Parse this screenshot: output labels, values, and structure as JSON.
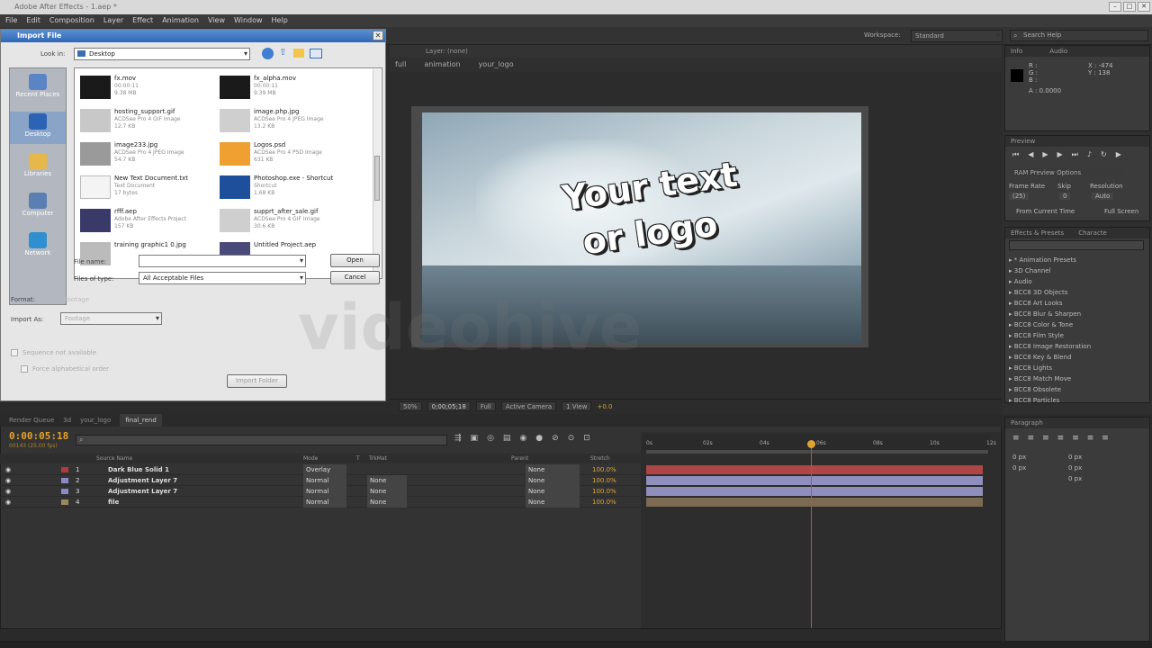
{
  "app": {
    "title": "Adobe After Effects - 1.aep *",
    "menu": [
      "File",
      "Edit",
      "Composition",
      "Layer",
      "Effect",
      "Animation",
      "View",
      "Window",
      "Help"
    ]
  },
  "workspace": {
    "label": "Workspace:",
    "value": "Standard",
    "search_placeholder": "Search Help"
  },
  "composition": {
    "layer_tab": "Layer: (none)",
    "nav": [
      "full",
      "animation",
      "your_logo"
    ],
    "canvas_text_line1": "Your text",
    "canvas_text_line2": "or logo",
    "zoom": "50%",
    "timecode": "0;00;05;18",
    "resolution": "Full",
    "camera": "Active Camera",
    "view": "1 View",
    "exposure": "+0.0"
  },
  "dialog": {
    "title": "Import File",
    "look_in_label": "Look in:",
    "look_in_value": "Desktop",
    "places": [
      "Recent Places",
      "Desktop",
      "Libraries",
      "Computer",
      "Network"
    ],
    "files": [
      {
        "name": "fx.mov",
        "sub1": "00:00:11",
        "sub2": "9.38 MB"
      },
      {
        "name": "fx_alpha.mov",
        "sub1": "00:00:11",
        "sub2": "9.39 MB"
      },
      {
        "name": "hosting_support.gif",
        "sub1": "ACDSee Pro 4 GIF Image",
        "sub2": "12.7 KB"
      },
      {
        "name": "image.php.jpg",
        "sub1": "ACDSee Pro 4 JPEG Image",
        "sub2": "13.2 KB"
      },
      {
        "name": "image233.jpg",
        "sub1": "ACDSee Pro 4 JPEG Image",
        "sub2": "54.7 KB"
      },
      {
        "name": "Logos.psd",
        "sub1": "ACDSee Pro 4 PSD Image",
        "sub2": "631 KB"
      },
      {
        "name": "New Text Document.txt",
        "sub1": "Text Document",
        "sub2": "17 bytes"
      },
      {
        "name": "Photoshop.exe - Shortcut",
        "sub1": "Shortcut",
        "sub2": "1.68 KB"
      },
      {
        "name": "rfff.aep",
        "sub1": "Adobe After Effects Project",
        "sub2": "157 KB"
      },
      {
        "name": "supprt_after_sale.gif",
        "sub1": "ACDSee Pro 4 GIF Image",
        "sub2": "30.6 KB"
      },
      {
        "name": "training graphic1 0.jpg",
        "sub1": "",
        "sub2": ""
      },
      {
        "name": "Untitled Project.aep",
        "sub1": "",
        "sub2": ""
      }
    ],
    "filename_label": "File name:",
    "filename_value": "",
    "filetype_label": "Files of type:",
    "filetype_value": "All Acceptable Files",
    "open_button": "Open",
    "cancel_button": "Cancel",
    "format_label": "Format:",
    "format_value": "Footage",
    "import_as_label": "Import As:",
    "import_as_value": "Footage",
    "seq_label": "Sequence not available",
    "force_label": "Force alphabetical order",
    "import_folder_button": "Import Folder",
    "watermark": "videohive"
  },
  "info": {
    "tab1": "Info",
    "tab2": "Audio",
    "r": "R :",
    "g": "G :",
    "b": "B :",
    "a": "A : 0.0000",
    "x": "X : -474",
    "y": "Y : 138"
  },
  "preview": {
    "title": "Preview",
    "ram": "RAM Preview Options",
    "frame_rate_label": "Frame Rate",
    "skip_label": "Skip",
    "resolution_label": "Resolution",
    "frame_rate": "(25)",
    "skip": "0",
    "resolution": "Auto",
    "from_current": "From Current Time",
    "full_screen": "Full Screen"
  },
  "effects": {
    "tab1": "Effects & Presets",
    "tab2": "Characte",
    "items": [
      "* Animation Presets",
      "3D Channel",
      "Audio",
      "BCC8 3D Objects",
      "BCC8 Art Looks",
      "BCC8 Blur & Sharpen",
      "BCC8 Color & Tone",
      "BCC8 Film Style",
      "BCC8 Image Restoration",
      "BCC8 Key & Blend",
      "BCC8 Lights",
      "BCC8 Match Move",
      "BCC8 Obsolete",
      "BCC8 Particles"
    ]
  },
  "paragraph": {
    "title": "Paragraph",
    "v1": "0 px",
    "v2": "0 px",
    "v3": "0 px",
    "v4": "0 px",
    "v5": "0 px"
  },
  "timeline": {
    "tabs": [
      "Render Queue",
      "3d",
      "your_logo",
      "final_rend"
    ],
    "timecode": "0:00:05:18",
    "fps": "00143 (25.00 fps)",
    "col_source": "Source Name",
    "col_mode": "Mode",
    "col_t": "T",
    "col_trkmat": "TrkMat",
    "col_parent": "Parent",
    "col_stretch": "Stretch",
    "ruler": [
      "0s",
      "02s",
      "04s",
      "06s",
      "08s",
      "10s",
      "12s"
    ],
    "layers": [
      {
        "num": "1",
        "name": "Dark Blue Solid 1",
        "mode": "Overlay",
        "trkmat": "",
        "parent": "None",
        "stretch": "100.0%",
        "color": "#b03a3a",
        "bar": "#b04545"
      },
      {
        "num": "2",
        "name": "Adjustment Layer 7",
        "mode": "Normal",
        "trkmat": "None",
        "parent": "None",
        "stretch": "100.0%",
        "color": "#8a8ac8",
        "bar": "#8f8fbe"
      },
      {
        "num": "3",
        "name": "Adjustment Layer 7",
        "mode": "Normal",
        "trkmat": "None",
        "parent": "None",
        "stretch": "100.0%",
        "color": "#8a8ac8",
        "bar": "#8f8fbe"
      },
      {
        "num": "4",
        "name": "file",
        "mode": "Normal",
        "trkmat": "None",
        "parent": "None",
        "stretch": "100.0%",
        "color": "#9a8a60",
        "bar": "#7c6a52"
      }
    ]
  },
  "playhead_fraction": 0.488
}
